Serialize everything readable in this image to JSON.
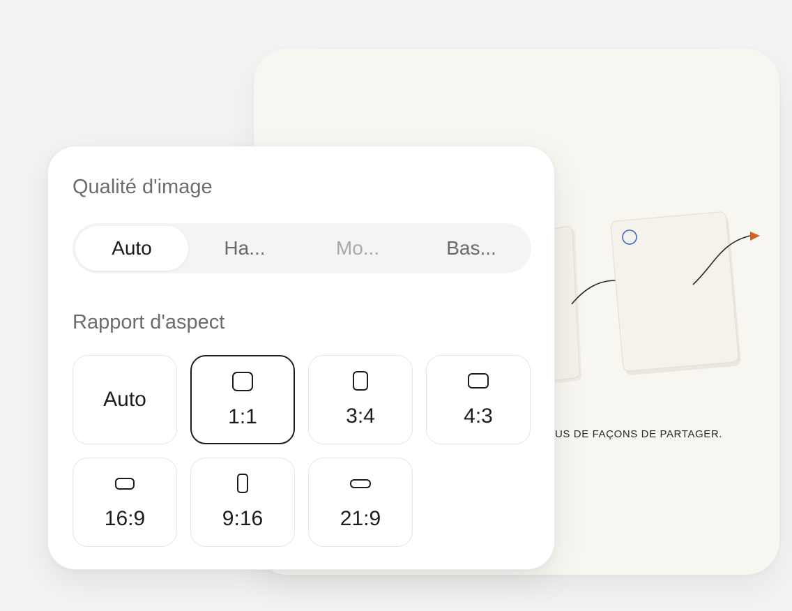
{
  "preview": {
    "caption": "US DE FAÇONS DE PARTAGER."
  },
  "colors": {
    "selection_circle": "#3a67c7",
    "arrow_accent": "#d2621f"
  },
  "settings": {
    "quality_title": "Qualité d'image",
    "quality_options": [
      {
        "label": "Auto",
        "selected": true
      },
      {
        "label": "Ha...",
        "selected": false
      },
      {
        "label": "Mo...",
        "selected": false
      },
      {
        "label": "Bas...",
        "selected": false
      }
    ],
    "aspect_title": "Rapport d'aspect",
    "aspect_options": [
      {
        "label": "Auto",
        "selected": false
      },
      {
        "label": "1:1",
        "selected": true
      },
      {
        "label": "3:4",
        "selected": false
      },
      {
        "label": "4:3",
        "selected": false
      },
      {
        "label": "16:9",
        "selected": false
      },
      {
        "label": "9:16",
        "selected": false
      },
      {
        "label": "21:9",
        "selected": false
      }
    ]
  }
}
